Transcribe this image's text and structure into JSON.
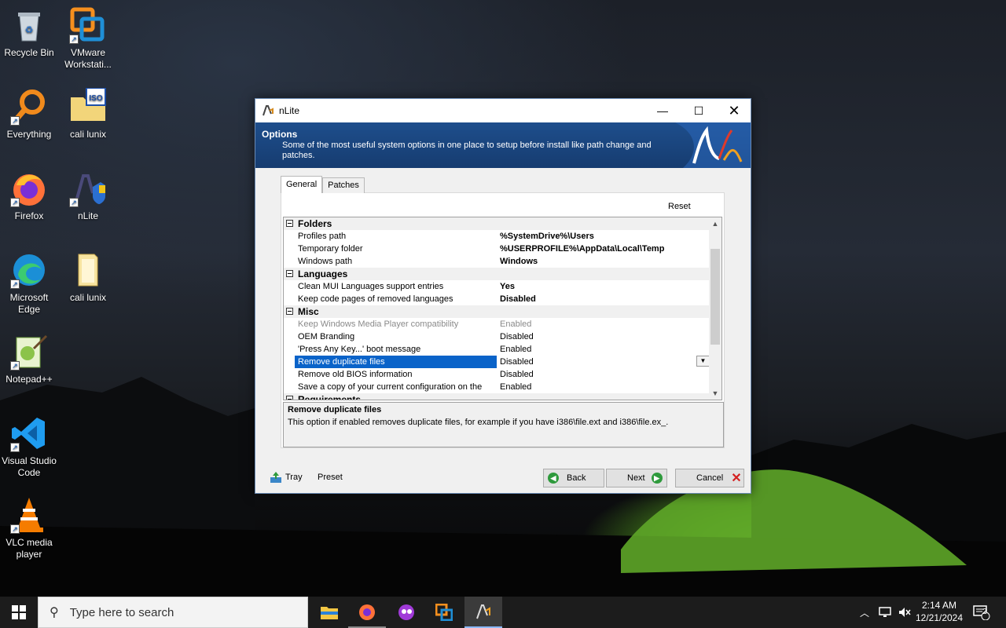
{
  "desktop": {
    "icons": [
      {
        "label": "Recycle Bin",
        "icon": "recycle-bin-icon"
      },
      {
        "label": "VMware Workstati...",
        "icon": "vmware-icon"
      },
      {
        "label": "Everything",
        "icon": "everything-search-icon"
      },
      {
        "label": "cali lunix",
        "icon": "iso-folder-icon"
      },
      {
        "label": "Firefox",
        "icon": "firefox-icon"
      },
      {
        "label": "nLite",
        "icon": "nlite-icon"
      },
      {
        "label": "Microsoft Edge",
        "icon": "edge-icon"
      },
      {
        "label": "cali lunix",
        "icon": "folder-icon"
      },
      {
        "label": "Notepad++",
        "icon": "notepadpp-icon"
      },
      {
        "label": "Visual Studio Code",
        "icon": "vscode-icon"
      },
      {
        "label": "VLC media player",
        "icon": "vlc-icon"
      }
    ]
  },
  "window": {
    "title": "nLite",
    "header": {
      "title": "Options",
      "description": "Some of the most useful system options in one place to setup before install like path change and patches."
    },
    "tabs": [
      {
        "label": "General",
        "active": true
      },
      {
        "label": "Patches",
        "active": false
      }
    ],
    "reset_label": "Reset",
    "grid": {
      "rows": [
        {
          "type": "category",
          "name": "Folders"
        },
        {
          "type": "prop",
          "name": "Profiles path",
          "value": "%SystemDrive%\\Users",
          "bold": true
        },
        {
          "type": "prop",
          "name": "Temporary folder",
          "value": "%USERPROFILE%\\AppData\\Local\\Temp",
          "bold": true
        },
        {
          "type": "prop",
          "name": "Windows path",
          "value": "Windows",
          "bold": true
        },
        {
          "type": "category",
          "name": "Languages"
        },
        {
          "type": "prop",
          "name": "Clean MUI Languages support entries",
          "value": "Yes",
          "bold": true
        },
        {
          "type": "prop",
          "name": "Keep code pages of removed languages",
          "value": "Disabled",
          "bold": true
        },
        {
          "type": "category",
          "name": "Misc"
        },
        {
          "type": "prop",
          "name": "Keep Windows Media Player compatibility",
          "value": "Enabled",
          "disabled": true
        },
        {
          "type": "prop",
          "name": "OEM Branding",
          "value": "Disabled"
        },
        {
          "type": "prop",
          "name": "'Press Any Key...' boot message",
          "value": "Enabled"
        },
        {
          "type": "prop",
          "name": "Remove duplicate files",
          "value": "Disabled",
          "selected": true
        },
        {
          "type": "prop",
          "name": "Remove old BIOS information",
          "value": "Disabled"
        },
        {
          "type": "prop",
          "name": "Save a copy of your current configuration on the ISO",
          "value": "Enabled"
        },
        {
          "type": "category",
          "name": "Requirements"
        }
      ]
    },
    "description_box": {
      "title": "Remove duplicate files",
      "text": "This option if enabled removes duplicate files, for example if you have i386\\file.ext and i386\\file.ex_."
    },
    "footer": {
      "tray_label": "Tray",
      "preset_label": "Preset",
      "back_label": "Back",
      "next_label": "Next",
      "cancel_label": "Cancel"
    }
  },
  "taskbar": {
    "search_placeholder": "Type here to search",
    "apps": [
      "file-explorer-icon",
      "firefox-icon",
      "app-icon",
      "vmware-icon",
      "nlite-icon"
    ],
    "clock": {
      "time": "2:14 AM",
      "date": "12/21/2024"
    },
    "notification_count": "2"
  },
  "colors": {
    "header_blue": "#1e4e8c",
    "selection": "#0a63c9",
    "taskbar": "#1c1c1c"
  }
}
